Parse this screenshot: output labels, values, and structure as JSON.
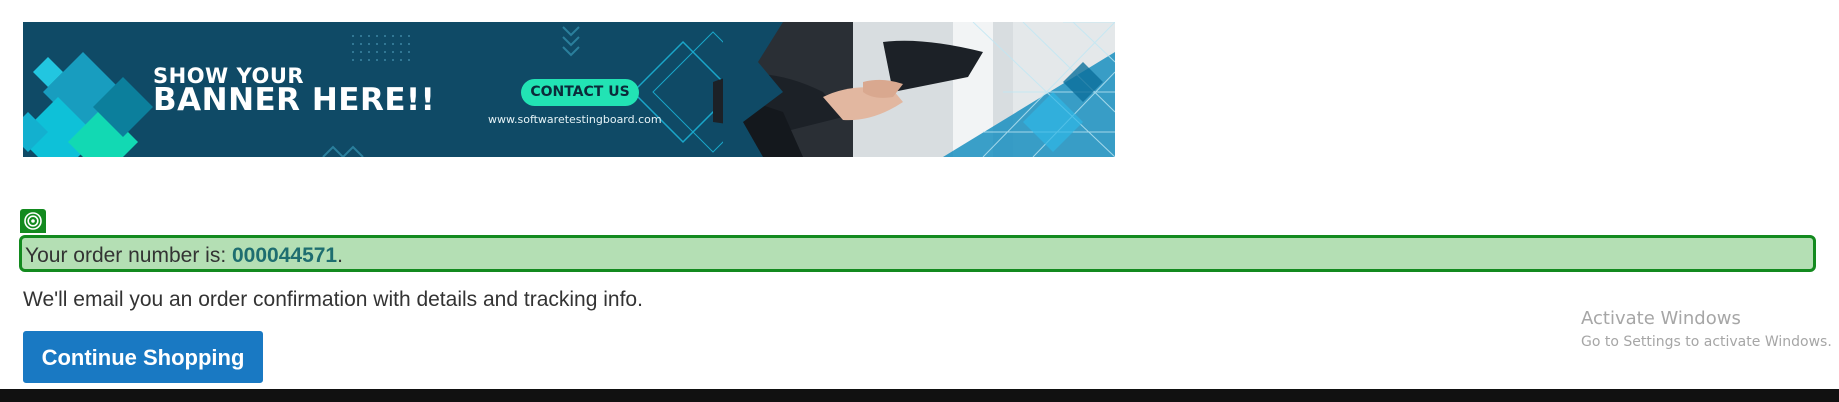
{
  "banner": {
    "line1": "SHOW YOUR",
    "line2": "BANNER HERE!!",
    "contact_label": "CONTACT US",
    "url": "www.softwaretestingboard.com"
  },
  "success": {
    "prefix": "Your order number is: ",
    "order_number": "000044571",
    "suffix": "."
  },
  "email_message": "We'll email you an order confirmation with details and tracking info.",
  "continue_button": "Continue Shopping",
  "watermark": {
    "title": "Activate Windows",
    "subtitle": "Go to Settings to activate Windows."
  },
  "colors": {
    "banner_bg": "#0f4a66",
    "contact_bg": "#22e3b4",
    "success_bg": "#b4dfb4",
    "success_border": "#138a1f",
    "order_number": "#1e6e70",
    "button_bg": "#1979c3"
  },
  "icons": {
    "message_icon": "target-icon"
  }
}
